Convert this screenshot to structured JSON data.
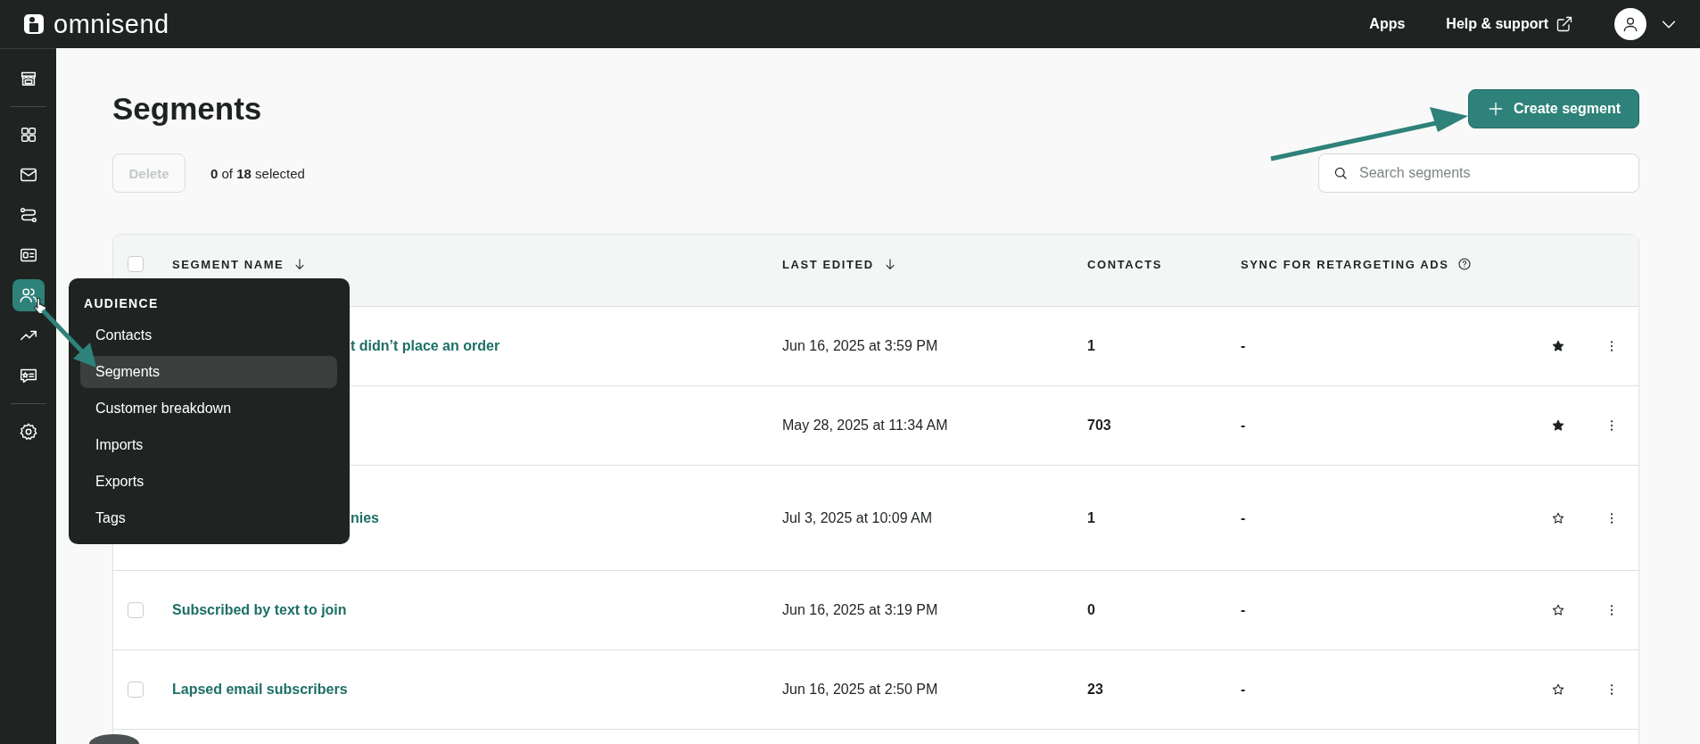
{
  "topbar": {
    "logo": "omnisend",
    "links": [
      "Apps",
      "Help & support"
    ]
  },
  "sidebar": {
    "items": [
      {
        "selected": false
      },
      {
        "selected": false
      },
      {
        "selected": false
      },
      {
        "selected": false
      },
      {
        "selected": false
      },
      {
        "selected": true
      },
      {
        "selected": false
      },
      {
        "selected": false
      },
      {
        "selected": false
      }
    ]
  },
  "page": {
    "title": "Segments",
    "create_button": "Create segment",
    "delete_button": {
      "label": "Delete",
      "disabled": true
    },
    "selection": "**0** of **18** selected",
    "search": {
      "placeholder": "Search segments"
    }
  },
  "table": {
    "select_all_checked": false,
    "columns": [
      "SEGMENT NAME",
      "LAST EDITED",
      "CONTACTS",
      "SYNC FOR RETARGETING ADS"
    ],
    "rows": [
      {
        "name": "t didn’t place an order",
        "covered": true,
        "last_edited": "Jun 16, 2025 at 3:59 PM",
        "contacts": "1",
        "sync": "-",
        "favorite": true
      },
      {
        "covered": true,
        "last_edited": "May 28, 2025 at 11:34 AM",
        "contacts": "703",
        "sync": "-",
        "favorite": true
      },
      {
        "name": "nies",
        "covered": true,
        "tall": true,
        "last_edited": "Jul 3, 2025 at 10:09 AM",
        "contacts": "1",
        "sync": "-",
        "favorite": false
      },
      {
        "name": "Subscribed by text to join",
        "covered": false,
        "checked": false,
        "last_edited": "Jun 16, 2025 at 3:19 PM",
        "contacts": "0",
        "sync": "-",
        "favorite": false
      },
      {
        "name": "Lapsed email subscribers",
        "covered": false,
        "checked": false,
        "last_edited": "Jun 16, 2025 at 2:50 PM",
        "contacts": "23",
        "sync": "-",
        "favorite": false
      }
    ]
  },
  "menu": {
    "title": "AUDIENCE",
    "items": [
      {
        "label": "Contacts",
        "selected": false
      },
      {
        "label": "Segments",
        "selected": true
      },
      {
        "label": "Customer breakdown",
        "selected": false
      },
      {
        "label": "Imports",
        "selected": false
      },
      {
        "label": "Exports",
        "selected": false
      },
      {
        "label": "Tags",
        "selected": false
      }
    ]
  }
}
